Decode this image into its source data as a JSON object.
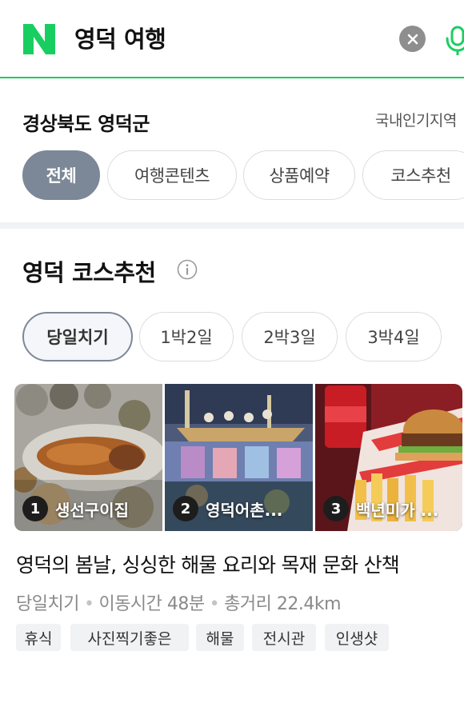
{
  "search": {
    "query": "영덕 여행",
    "logo_text": "N",
    "accent_color": "#19ce60"
  },
  "region": {
    "title": "경상북도 영덕군",
    "link_label": "국내인기지역",
    "categories": [
      {
        "label": "전체",
        "active": true
      },
      {
        "label": "여행콘텐츠",
        "active": false
      },
      {
        "label": "상품예약",
        "active": false
      },
      {
        "label": "코스추천",
        "active": false
      }
    ]
  },
  "course_section": {
    "title": "영덕 코스추천",
    "info_icon": "info-circle-icon",
    "durations": [
      {
        "label": "당일치기",
        "active": true
      },
      {
        "label": "1박2일",
        "active": false
      },
      {
        "label": "2박3일",
        "active": false
      },
      {
        "label": "3박4일",
        "active": false
      }
    ],
    "course": {
      "places": [
        {
          "number": "1",
          "name": "생선구이집"
        },
        {
          "number": "2",
          "name": "영덕어촌..."
        },
        {
          "number": "3",
          "name": "백년미가 ..."
        }
      ],
      "title": "영덕의 봄날, 싱싱한 해물 요리와 목재 문화 산책",
      "duration": "당일치기",
      "travel_time": "이동시간 48분",
      "distance": "총거리 22.4km",
      "tags": [
        "휴식",
        "사진찍기좋은",
        "해물",
        "전시관",
        "인생샷"
      ]
    }
  }
}
